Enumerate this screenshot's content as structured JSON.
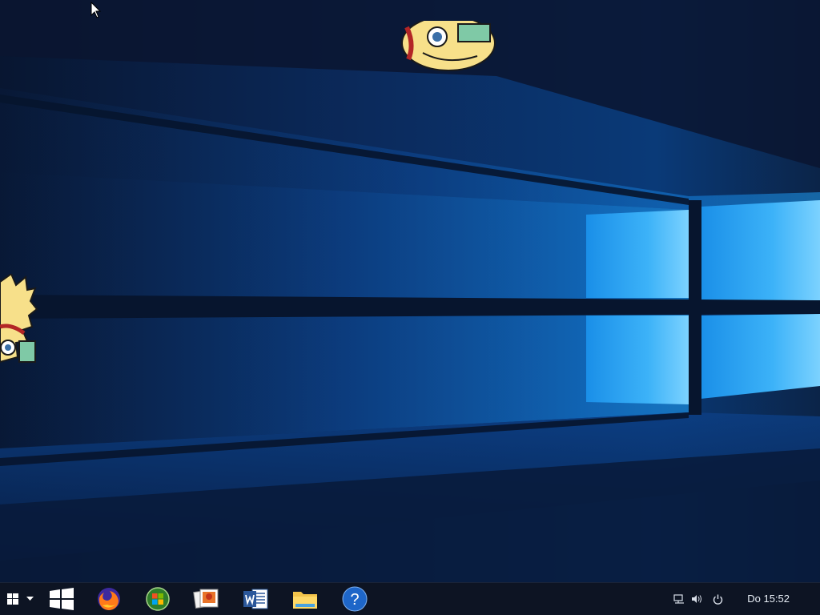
{
  "desktop": {
    "wallpaper": "windows-10-hero",
    "colors": {
      "dark_base": "#0a1a33",
      "beam_light": "#5cc4ff",
      "beam_mid": "#1f7fd6",
      "taskbar": "#0d1423"
    }
  },
  "taskbar": {
    "start": {
      "icon": "windows-logo-icon",
      "menu_icon": "chevron-down-icon"
    },
    "pinned": [
      {
        "name": "windows-logo",
        "icon": "windows-logo-icon"
      },
      {
        "name": "firefox",
        "icon": "firefox-icon"
      },
      {
        "name": "windows-media",
        "icon": "windows-media-icon"
      },
      {
        "name": "photo-gallery",
        "icon": "photo-gallery-icon"
      },
      {
        "name": "word",
        "icon": "word-icon"
      },
      {
        "name": "file-explorer",
        "icon": "folder-icon"
      },
      {
        "name": "help",
        "icon": "help-icon",
        "glyph": "?"
      }
    ],
    "tray": {
      "network_icon": "network-icon",
      "volume_icon": "volume-icon",
      "power_icon": "power-icon",
      "clock": "Do 15:52"
    }
  }
}
